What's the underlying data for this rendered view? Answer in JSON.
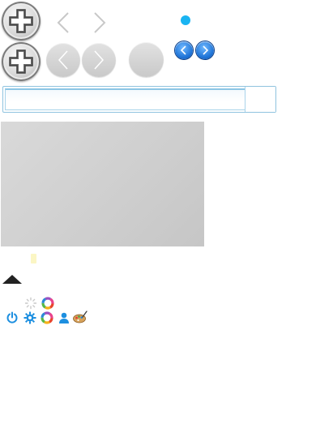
{
  "toolbar": {
    "row1": [
      "plus-icon",
      "chevron-left-icon",
      "chevron-right-icon",
      "dot-icon"
    ],
    "row2": [
      "plus-icon",
      "arrow-left-icon",
      "arrow-right-icon",
      "blank-circle",
      "blue-arrow-left-icon",
      "blue-arrow-right-icon"
    ]
  },
  "colors": {
    "accent_blue": "#1e73d6",
    "dot_cyan": "#19b4f2",
    "search_border": "#8fc3df",
    "panel_gray": "#cfcfcf"
  },
  "search": {
    "value": "",
    "placeholder": ""
  },
  "icons": {
    "row_a": [
      "loading-icon",
      "color-wheel-icon"
    ],
    "row_b": [
      "power-icon",
      "gear-icon",
      "color-wheel-icon",
      "user-icon",
      "palette-icon"
    ],
    "misc": [
      "marker-icon",
      "collapse-up-icon"
    ]
  }
}
